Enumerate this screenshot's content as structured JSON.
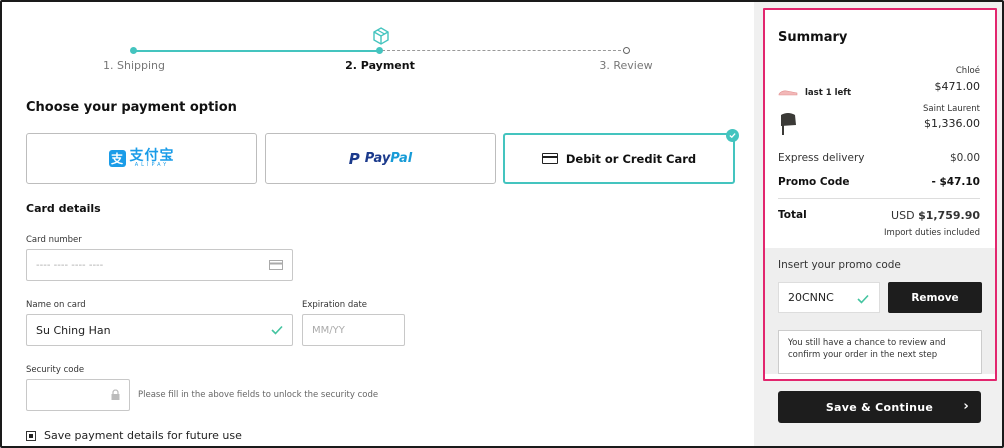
{
  "steps": [
    {
      "label": "1. Shipping",
      "state": "done"
    },
    {
      "label": "2. Payment",
      "state": "active"
    },
    {
      "label": "3. Review",
      "state": "pending"
    }
  ],
  "payment": {
    "title": "Choose your payment option",
    "options": {
      "alipay": {
        "cn": "支付宝",
        "en": "ALIPAY"
      },
      "paypal": {
        "pay": "Pay",
        "pal": "Pal",
        "logo": "P"
      },
      "card": {
        "label": "Debit or Credit Card",
        "selected": true
      }
    }
  },
  "card_details": {
    "heading": "Card details",
    "card_number": {
      "label": "Card number",
      "placeholder": "---- ---- ---- ----"
    },
    "name_on_card": {
      "label": "Name on card",
      "value": "Su Ching Han"
    },
    "expiration": {
      "label": "Expiration date",
      "placeholder": "MM/YY"
    },
    "security": {
      "label": "Security code",
      "hint": "Please fill in the above fields to unlock the security code"
    },
    "save_label": "Save payment details for future use"
  },
  "summary": {
    "title": "Summary",
    "items": [
      {
        "brand": "Chloé",
        "note": "last 1 left",
        "price": "$471.00"
      },
      {
        "brand": "Saint Laurent",
        "price": "$1,336.00"
      }
    ],
    "delivery": {
      "label": "Express delivery",
      "value": "$0.00"
    },
    "promo": {
      "label": "Promo Code",
      "value": "- $47.10"
    },
    "total": {
      "label": "Total",
      "currency": "USD",
      "value": "$1,759.90",
      "duties": "Import duties included"
    },
    "promo_section": {
      "label": "Insert your promo code",
      "code": "20CNNC",
      "remove": "Remove",
      "note": "You still have a chance to review and confirm your order in the next step"
    },
    "continue_label": "Save & Continue"
  },
  "colors": {
    "accent": "#44c4bf",
    "highlight": "#e2266e",
    "dark": "#1d1d1d"
  }
}
